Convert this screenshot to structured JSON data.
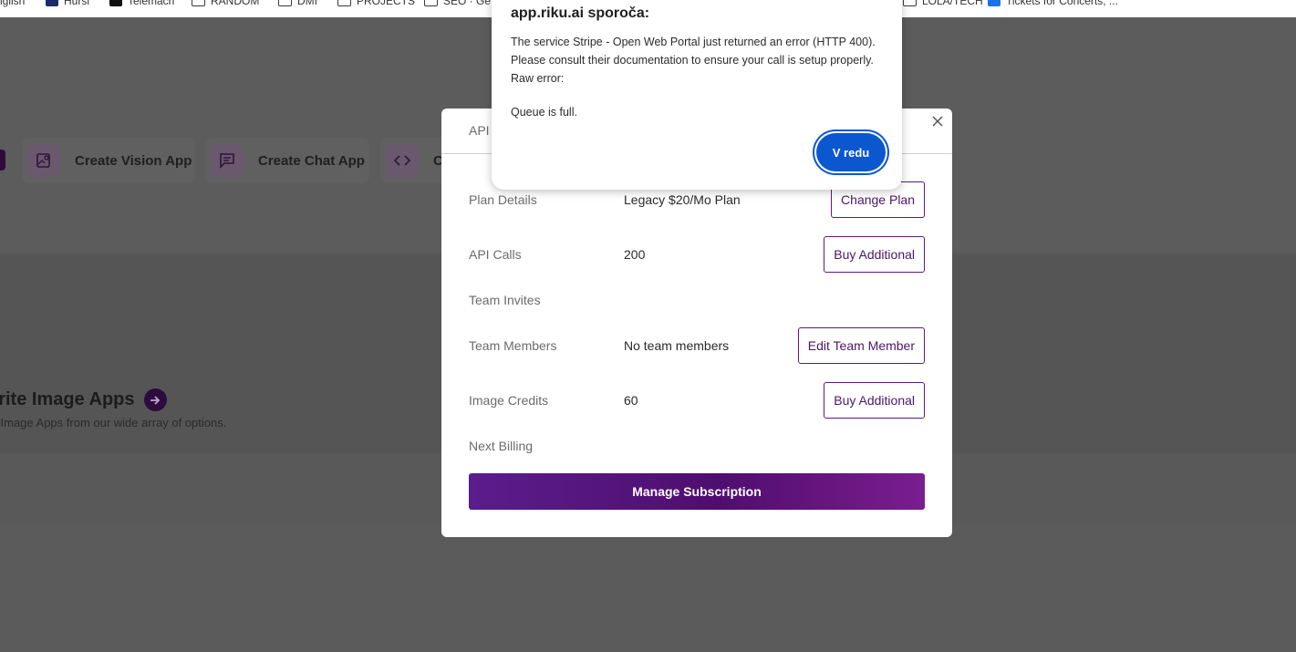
{
  "bookmarks": [
    {
      "label": "nglish",
      "icon": "none"
    },
    {
      "label": "Hursi",
      "icon": "site-icon"
    },
    {
      "label": "Telemach",
      "icon": "site-icon"
    },
    {
      "label": "RANDOM",
      "icon": "folder-icon"
    },
    {
      "label": "DMI",
      "icon": "folder-icon"
    },
    {
      "label": "PROJECTS",
      "icon": "folder-icon"
    },
    {
      "label": "SEO · Ge",
      "icon": "folder-icon"
    },
    {
      "label": "LOLA/TECH",
      "icon": "folder-icon"
    },
    {
      "label": "Tickets for Concerts, ...",
      "icon": "site-icon"
    }
  ],
  "background": {
    "apps": [
      {
        "label": "Create Vision App",
        "icon": "vision-image-icon"
      },
      {
        "label": "Create Chat App",
        "icon": "chat-icon"
      },
      {
        "label": "C",
        "icon": "code-icon"
      }
    ],
    "favorites_title": "orite Image Apps",
    "favorites_subtitle": "l Image Apps from our wide array of options."
  },
  "modal": {
    "header_title": "API",
    "rows": {
      "plan": {
        "label": "Plan Details",
        "value": "Legacy $20/Mo Plan",
        "button": "Change Plan"
      },
      "api_calls": {
        "label": "API Calls",
        "value": "200",
        "button": "Buy Additional"
      },
      "team_invites": {
        "label": "Team Invites"
      },
      "team_members": {
        "label": "Team Members",
        "value": "No team members",
        "button": "Edit Team Member"
      },
      "image_credits": {
        "label": "Image Credits",
        "value": "60",
        "button": "Buy Additional"
      },
      "next_billing": {
        "label": "Next Billing"
      }
    },
    "manage_button": "Manage Subscription"
  },
  "alert": {
    "title": "app.riku.ai sporoča:",
    "message": "The service Stripe - Open Web Portal just returned an error (HTTP 400). Please consult their documentation to ensure your call is setup properly. Raw error:",
    "detail": "Queue is full.",
    "ok_label": "V redu"
  },
  "colors": {
    "accent_purple": "#4a1766",
    "dialog_blue": "#0b57d0",
    "overlay": "#5b5b5b"
  }
}
